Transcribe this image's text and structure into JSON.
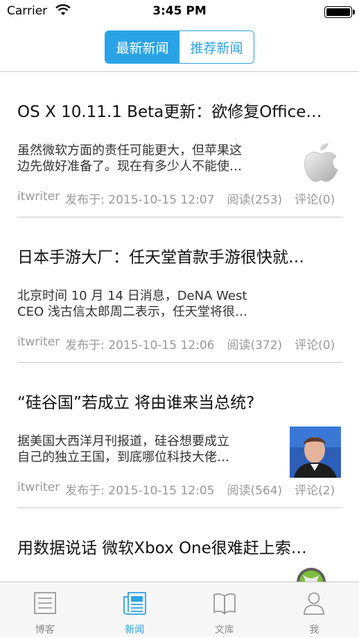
{
  "status_bar": {
    "carrier": "Carrier",
    "time": "3:45 PM"
  },
  "segmented": {
    "latest": "最新新闻",
    "recommended": "推荐新闻"
  },
  "news": [
    {
      "title": "OS X 10.11.1 Beta更新：欲修复Office…",
      "summary_line1": "虽然微软方面的责任可能更大，但苹果这",
      "summary_line2": "边先做好准备了。现在有多少人不能使…",
      "author": "itwriter",
      "published": "发布于: 2015-10-15 12:07",
      "reads": "阅读(253)",
      "comments": "评论(0)",
      "thumb_icon": "apple-logo"
    },
    {
      "title": "日本手游大厂：任天堂首款手游很快就…",
      "summary_line1": "北京时间 10 月 14 日消息，DeNA West",
      "summary_line2": "CEO 浅古信太郎周二表示，任天堂将很…",
      "author": "itwriter",
      "published": "发布于: 2015-10-15 12:06",
      "reads": "阅读(372)",
      "comments": "评论(0)"
    },
    {
      "title": "“硅谷国”若成立 将由谁来当总统?",
      "summary_line1": "据美国大西洋月刊报道，硅谷想要成立",
      "summary_line2": "自己的独立王国，到底哪位科技大佬…",
      "author": "itwriter",
      "published": "发布于: 2015-10-15 12:05",
      "reads": "阅读(564)",
      "comments": "评论(2)",
      "thumb_icon": "person-photo"
    },
    {
      "title": "用数据说话 微软Xbox One很难赶上索…",
      "thumb_icon": "xbox-logo"
    }
  ],
  "tabs": [
    {
      "label": "博客",
      "icon": "blog-icon"
    },
    {
      "label": "新闻",
      "icon": "news-icon"
    },
    {
      "label": "文库",
      "icon": "library-icon"
    },
    {
      "label": "我",
      "icon": "profile-icon"
    }
  ],
  "colors": {
    "accent": "#2aa3e6",
    "meta": "#999999",
    "divider": "#c8c8c8"
  }
}
